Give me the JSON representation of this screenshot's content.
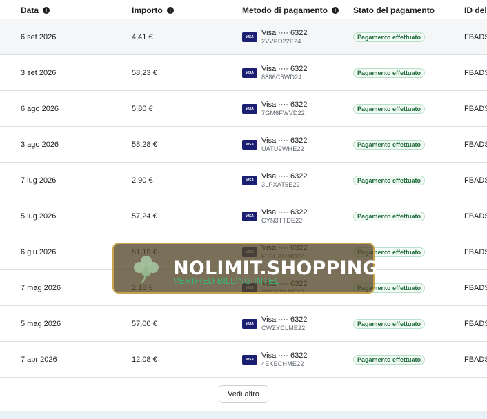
{
  "table": {
    "headers": {
      "date": "Data",
      "amount": "Importo",
      "method": "Metodo di pagamento",
      "status": "Stato del pagamento",
      "id": "ID della"
    },
    "rows": [
      {
        "date": "6 set 2026",
        "amount": "4,41 €",
        "card": "Visa ···· 6322",
        "code": "2VVPD22E24",
        "status": "Pagamento effettuato",
        "id": "FBADS"
      },
      {
        "date": "3 set 2026",
        "amount": "58,23 €",
        "card": "Visa ···· 6322",
        "code": "8886C5WD24",
        "status": "Pagamento effettuato",
        "id": "FBADS"
      },
      {
        "date": "6 ago 2026",
        "amount": "5,80 €",
        "card": "Visa ···· 6322",
        "code": "7GM6FWVD22",
        "status": "Pagamento effettuato",
        "id": "FBADS"
      },
      {
        "date": "3 ago 2026",
        "amount": "58,28 €",
        "card": "Visa ···· 6322",
        "code": "UATU9WHE22",
        "status": "Pagamento effettuato",
        "id": "FBADS"
      },
      {
        "date": "7 lug 2026",
        "amount": "2,90 €",
        "card": "Visa ···· 6322",
        "code": "3LPXAT5E22",
        "status": "Pagamento effettuato",
        "id": "FBADS"
      },
      {
        "date": "5 lug 2026",
        "amount": "57,24 €",
        "card": "Visa ···· 6322",
        "code": "CYN3TTDE22",
        "status": "Pagamento effettuato",
        "id": "FBADS"
      },
      {
        "date": "6 giu 2026",
        "amount": "51,19 €",
        "card": "Visa ···· 6322",
        "code": "F5BUAOMD22",
        "status": "Pagamento effettuato",
        "id": "FBADS"
      },
      {
        "date": "7 mag 2026",
        "amount": "2,18 €",
        "card": "Visa ···· 6322",
        "code": "RXEGRLDE22",
        "status": "Pagamento effettuato",
        "id": "FBADS"
      },
      {
        "date": "5 mag 2026",
        "amount": "57,00 €",
        "card": "Visa ···· 6322",
        "code": "CWZYCLME22",
        "status": "Pagamento effettuato",
        "id": "FBADS"
      },
      {
        "date": "7 apr 2026",
        "amount": "12,08 €",
        "card": "Visa ···· 6322",
        "code": "4EKECHME22",
        "status": "Pagamento effettuato",
        "id": "FBADS"
      }
    ],
    "visa_badge": "VISA"
  },
  "more_button": "Vedi altro",
  "watermark": {
    "title": "NOLIMIT.SHOPPING",
    "subtitle": "VERIFIED BILLING INTEL",
    "icon": "clover-icon"
  },
  "colors": {
    "status_green": "#1d6b38",
    "visa_blue": "#1a1f71",
    "watermark_border": "#c8a24a"
  }
}
